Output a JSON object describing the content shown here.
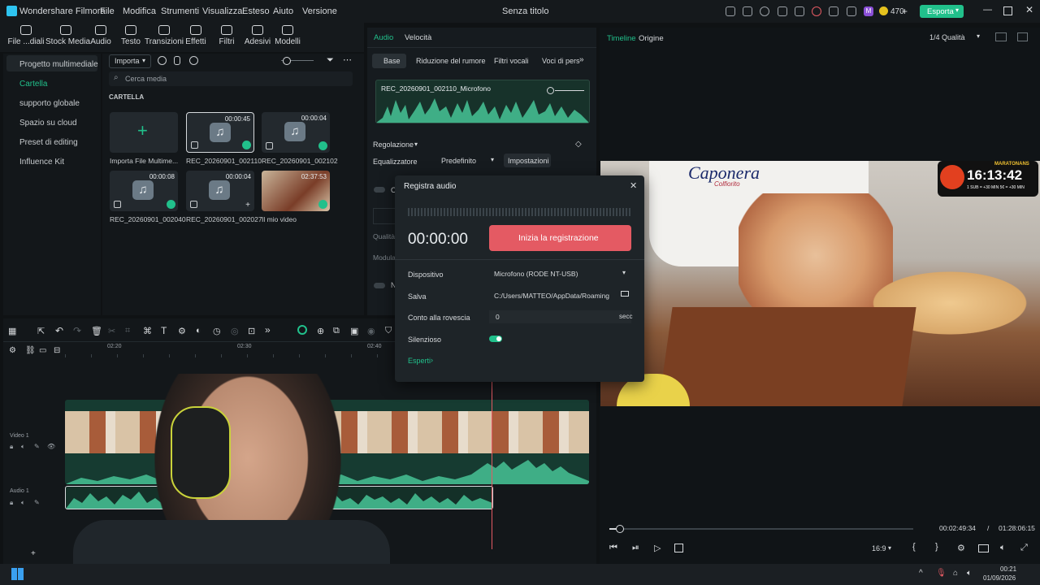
{
  "app": {
    "name": "Wondershare Filmora",
    "doc_title": "Senza titolo"
  },
  "menu": [
    "File",
    "Modifica",
    "Strumenti",
    "Visualizza",
    "Esteso",
    "Aiuto",
    "Versione"
  ],
  "title_right": {
    "credits": "470",
    "export_label": "Esporta"
  },
  "toolbar": [
    {
      "label": "File ...diali"
    },
    {
      "label": "Stock Media"
    },
    {
      "label": "Audio"
    },
    {
      "label": "Testo"
    },
    {
      "label": "Transizioni"
    },
    {
      "label": "Effetti"
    },
    {
      "label": "Filtri"
    },
    {
      "label": "Adesivi"
    },
    {
      "label": "Modelli"
    }
  ],
  "leftnav": {
    "items": [
      "Progetto multimediale",
      "Cartella",
      "supporto globale",
      "Spazio su cloud",
      "Preset di editing",
      "Influence Kit"
    ]
  },
  "media": {
    "import_label": "Importa",
    "search_placeholder": "Cerca media",
    "section": "CARTELLA",
    "items": [
      {
        "label": "Importa File Multime...",
        "dur": ""
      },
      {
        "label": "REC_20260901_002110",
        "dur": "00:00:45"
      },
      {
        "label": "REC_20260901_002102",
        "dur": "00:00:04"
      },
      {
        "label": "REC_20260901_002040",
        "dur": "00:00:08"
      },
      {
        "label": "REC_20260901_002027",
        "dur": "00:00:04"
      },
      {
        "label": "Il mio video",
        "dur": "02:37:53"
      }
    ]
  },
  "audiopanel": {
    "tabs": [
      "Audio",
      "Velocità"
    ],
    "subtabs": [
      "Base",
      "Riduzione del rumore",
      "Filtri vocali",
      "Voci di pers"
    ],
    "clip": "REC_20260901_002110_Microfono",
    "section": "Regolazione",
    "eq_label": "Equalizzatore",
    "eq_value": "Predefinito",
    "settings_label": "Impostazioni",
    "row_o": "O",
    "quality": "Qualità",
    "modula": "Modula",
    "row_n": "N"
  },
  "preview": {
    "tabs": [
      "Timeline",
      "Origine"
    ],
    "quality": "1/4 Qualità",
    "current_time": "00:02:49:34",
    "separator": "/",
    "total_time": "01:28:06:15",
    "ratio": "16:9",
    "brand": "Caponera",
    "brand_sub": "Colfiorito",
    "overlay_time": "16:13:42",
    "overlay_title": "MARATONANS",
    "overlay_line": "1 SUB = +30 MIN   5€ = +30 MIN",
    "progress": 0.03
  },
  "timeline": {
    "ticks": [
      "02:20",
      "02:30",
      "02:40"
    ],
    "tracks": [
      "Video 1",
      "Audio 1"
    ]
  },
  "dialog": {
    "title": "Registra audio",
    "time": "00:00:00",
    "record_button": "Inizia la registrazione",
    "device_label": "Dispositivo",
    "device_value": "Microfono (RODE NT-USB)",
    "save_label": "Salva",
    "save_value": "C:/Users/MATTEO/AppData/Roaming",
    "countdown_label": "Conto alla rovescia",
    "countdown_value": "0",
    "countdown_unit": "secc",
    "silent_label": "Silenzioso",
    "expert_label": "Esperti"
  },
  "taskbar": {
    "time": "00:21",
    "date": "01/09/2026"
  },
  "colors": {
    "accent": "#21c08b",
    "record": "#e45a63",
    "bg": "#0f1214"
  }
}
